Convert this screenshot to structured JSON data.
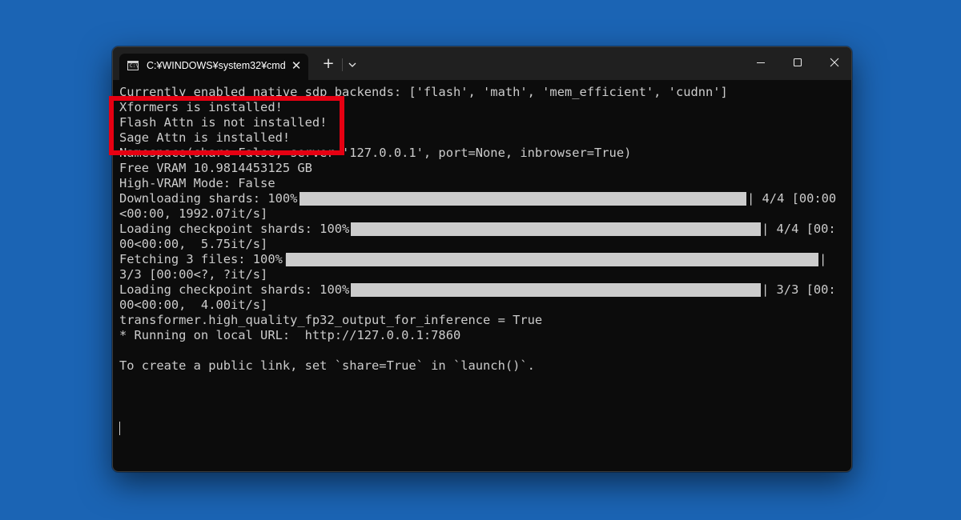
{
  "window": {
    "tab_title": "C:¥WINDOWS¥system32¥cmd",
    "tab_icon_text": "C:\\",
    "tab_close_glyph": "✕",
    "new_tab_glyph": "+"
  },
  "terminal": {
    "lines": [
      "Currently enabled native sdp backends: ['flash', 'math', 'mem_efficient', 'cudnn']",
      "Xformers is installed!",
      "Flash Attn is not installed!",
      "Sage Attn is installed!",
      "Namespace(share=False, server='127.0.0.1', port=None, inbrowser=True)",
      "Free VRAM 10.9814453125 GB",
      "High-VRAM Mode: False",
      "Downloading shards: 100%|",
      "<00:00, 1992.07it/s]",
      "Loading checkpoint shards: 100%|",
      "00<00:00,  5.75it/s]",
      "Fetching 3 files: 100%|",
      "3/3 [00:00<?, ?it/s]",
      "Loading checkpoint shards: 100%|",
      "00<00:00,  4.00it/s]",
      "transformer.high_quality_fp32_output_for_inference = True",
      "* Running on local URL:  http://127.0.0.1:7860",
      "",
      "To create a public link, set `share=True` in `launch()`."
    ],
    "progress_suffixes": {
      "downloading": "| 4/4 [00:00",
      "loading1": "| 4/4 [00:",
      "fetching": "|",
      "loading2": "| 3/3 [00:"
    },
    "progress": {
      "downloading": 1.0,
      "loading1": 1.0,
      "fetching": 1.0,
      "loading2": 1.0
    }
  },
  "colors": {
    "desktop": "#1b64b4",
    "terminal_bg": "#0c0c0c",
    "terminal_text": "#cccccc",
    "titlebar": "#202020",
    "highlight_border": "#e60012"
  }
}
